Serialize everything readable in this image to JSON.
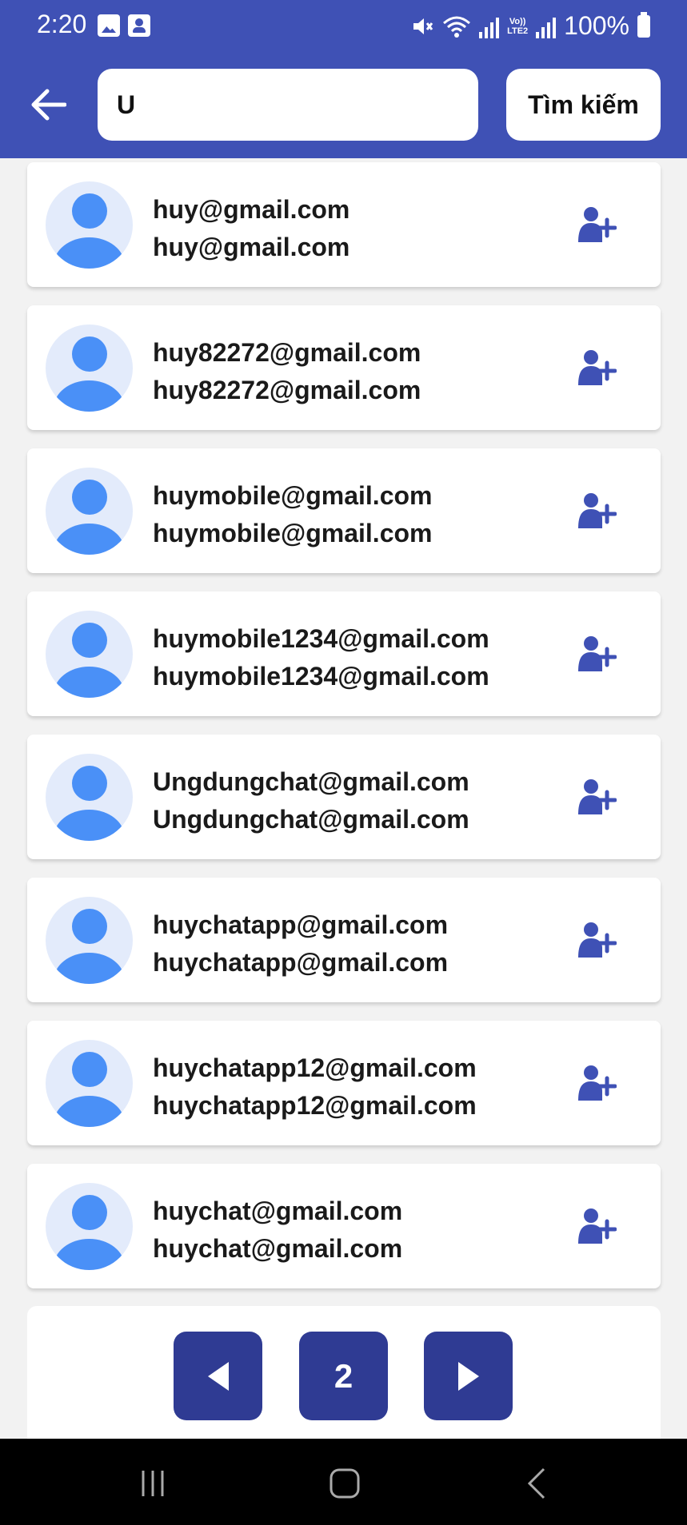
{
  "status_bar": {
    "time": "2:20",
    "battery": "100%",
    "volte_line1": "Vo))",
    "volte_line2": "LTE2"
  },
  "header": {
    "search_value": "U",
    "search_button_label": "Tìm kiếm"
  },
  "users": [
    {
      "name": "huy@gmail.com",
      "email": "huy@gmail.com"
    },
    {
      "name": "huy82272@gmail.com",
      "email": "huy82272@gmail.com"
    },
    {
      "name": "huymobile@gmail.com",
      "email": "huymobile@gmail.com"
    },
    {
      "name": "huymobile1234@gmail.com",
      "email": "huymobile1234@gmail.com"
    },
    {
      "name": "Ungdungchat@gmail.com",
      "email": "Ungdungchat@gmail.com"
    },
    {
      "name": "huychatapp@gmail.com",
      "email": "huychatapp@gmail.com"
    },
    {
      "name": "huychatapp12@gmail.com",
      "email": "huychatapp12@gmail.com"
    },
    {
      "name": "huychat@gmail.com",
      "email": "huychat@gmail.com"
    }
  ],
  "pagination": {
    "current_page": "2"
  },
  "colors": {
    "header": "#3f51b5",
    "accent": "#2f3b93",
    "avatar_bg": "#e3ebfb",
    "avatar_fg": "#4a90f7",
    "add_icon": "#3f51b5"
  },
  "icons": {
    "back": "arrow-left-icon",
    "add_friend": "person-add-icon",
    "prev": "triangle-left-icon",
    "next": "triangle-right-icon"
  }
}
